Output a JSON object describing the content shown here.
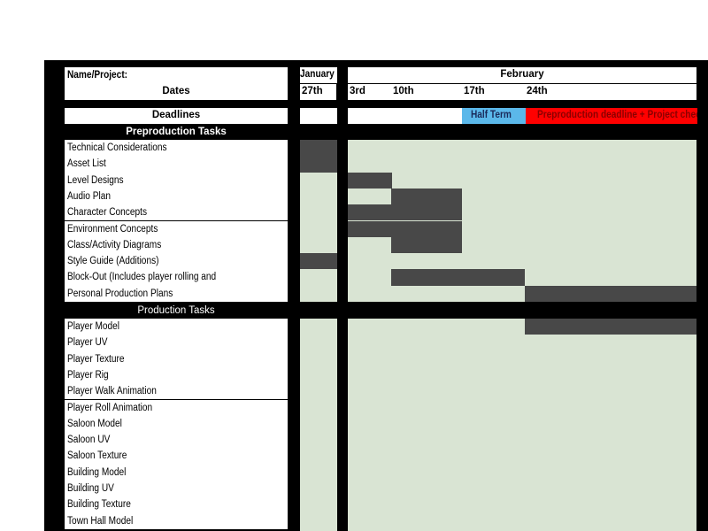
{
  "header": {
    "name_label": "Name/Project:",
    "dates_label": "Dates",
    "deadlines_label": "Deadlines",
    "months": [
      {
        "name": "January",
        "weeks": [
          "27th"
        ]
      },
      {
        "name": "February",
        "weeks": [
          "3rd",
          "10th",
          "17th",
          "24th"
        ]
      }
    ]
  },
  "deadlines": {
    "half_term": {
      "label": "Half Term",
      "week": "17th",
      "color": "#5bb8ea"
    },
    "preproduction": {
      "label": "Preproduction deadline + Project check",
      "week": "24th",
      "color": "#ff0000"
    }
  },
  "colors": {
    "background": "#000000",
    "empty_cell": "#d9e4d3",
    "scheduled_cell": "#484848"
  },
  "sections": [
    {
      "title": "Preproduction Tasks",
      "tasks": [
        {
          "name": "Technical Considerations",
          "weeks": [
            "27th"
          ]
        },
        {
          "name": "Asset List",
          "weeks": [
            "27th"
          ]
        },
        {
          "name": "Level Designs",
          "weeks": [
            "3rd"
          ]
        },
        {
          "name": "Audio Plan",
          "weeks": [
            "10th"
          ]
        },
        {
          "name": "Character Concepts",
          "weeks": [
            "3rd",
            "10th"
          ]
        },
        {
          "name": "Environment Concepts",
          "weeks": [
            "3rd",
            "10th"
          ]
        },
        {
          "name": "Class/Activity Diagrams",
          "weeks": [
            "10th"
          ]
        },
        {
          "name": "Style Guide (Additions)",
          "weeks": [
            "27th"
          ]
        },
        {
          "name": "Block-Out (Includes player rolling and destruction)",
          "weeks": [
            "10th",
            "17th"
          ]
        },
        {
          "name": "Personal Production Plans",
          "weeks": [
            "24th"
          ]
        }
      ]
    },
    {
      "title": "Production Tasks",
      "tasks": [
        {
          "name": "Player Model",
          "weeks": [
            "24th"
          ]
        },
        {
          "name": "Player UV",
          "weeks": []
        },
        {
          "name": "Player Texture",
          "weeks": []
        },
        {
          "name": "Player Rig",
          "weeks": []
        },
        {
          "name": "Player Walk Animation",
          "weeks": []
        },
        {
          "name": "Player Roll Animation",
          "weeks": []
        },
        {
          "name": "Saloon Model",
          "weeks": []
        },
        {
          "name": "Saloon UV",
          "weeks": []
        },
        {
          "name": "Saloon Texture",
          "weeks": []
        },
        {
          "name": "Building Model",
          "weeks": []
        },
        {
          "name": "Building UV",
          "weeks": []
        },
        {
          "name": "Building Texture",
          "weeks": []
        },
        {
          "name": "Town Hall Model",
          "weeks": []
        }
      ]
    }
  ]
}
